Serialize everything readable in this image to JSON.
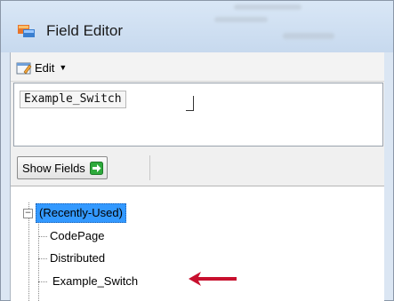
{
  "window": {
    "title": "Field Editor",
    "app_icon": "field-editor-app-icon"
  },
  "toolbar": {
    "edit_label": "Edit",
    "edit_icon": "edit-icon",
    "dropdown_icon": "chevron-down-icon"
  },
  "editor": {
    "token_text": "Example_Switch"
  },
  "show_fields": {
    "label": "Show Fields",
    "icon": "green-arrow-right-icon"
  },
  "tree": {
    "root_label": "(Recently-Used)",
    "items": [
      {
        "label": "CodePage"
      },
      {
        "label": "Distributed"
      },
      {
        "label": "Example_Switch"
      }
    ],
    "annotation_icon": "red-arrow-left-icon"
  },
  "colors": {
    "selection": "#3399ff",
    "annotation_arrow": "#c8102e",
    "show_fields_icon": "#2eaa3c"
  }
}
